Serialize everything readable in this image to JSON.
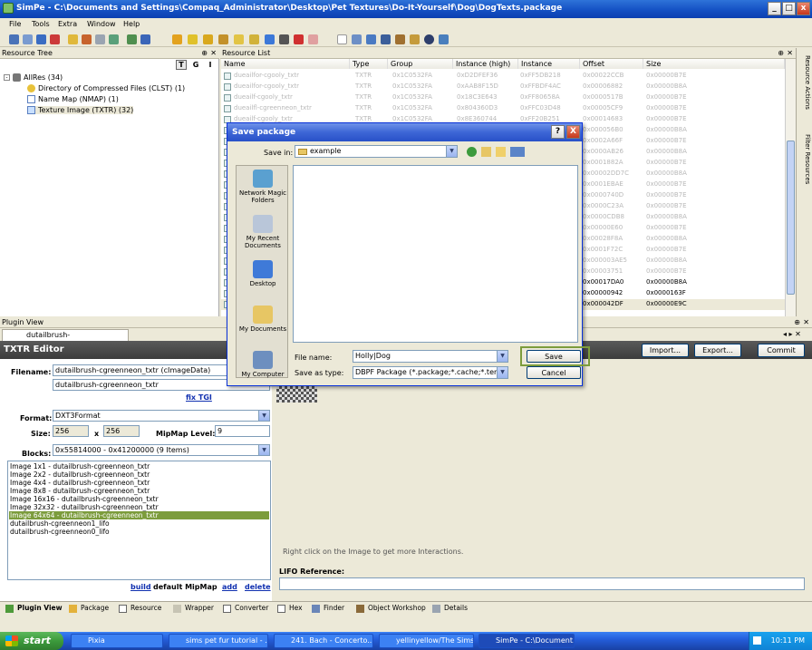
{
  "window": {
    "title": "SimPe - C:\\Documents and Settings\\Compaq_Administrator\\Desktop\\Pet Textures\\Do-It-Yourself\\Dog\\DogTexts.package"
  },
  "menu": [
    "File",
    "Tools",
    "Extra",
    "Window",
    "Help"
  ],
  "resource_tree": {
    "title": "Resource Tree",
    "view_buttons": [
      "T",
      "G",
      "I"
    ],
    "items": [
      {
        "label": "AllRes (34)"
      },
      {
        "label": "Directory of Compressed Files (CLST) (1)"
      },
      {
        "label": "Name Map (NMAP) (1)"
      },
      {
        "label": "Texture Image (TXTR) (32)"
      }
    ]
  },
  "resource_list": {
    "title": "Resource List",
    "columns": [
      "Name",
      "Type",
      "Group",
      "Instance (high)",
      "Instance",
      "Offset",
      "Size"
    ],
    "rows": [
      [
        "dueailfor-cgooly_txtr",
        "TXTR",
        "0x1C0532FA",
        "0xD2DFEF36",
        "0xFF5DB218",
        "0x00022CCB",
        "0x00000B7E"
      ],
      [
        "dueailfor-cgooly_txtr",
        "TXTR",
        "0x1C0532FA",
        "0xAAB8F15D",
        "0xFFBDF4AC",
        "0x00006882",
        "0x00000B8A"
      ],
      [
        "dueailf-cgooly_txtr",
        "TXTR",
        "0x1C0532FA",
        "0x18C3E643",
        "0xFF80658A",
        "0x0000517B",
        "0x00000B7E"
      ],
      [
        "dueailfl-cgreenneon_txtr",
        "TXTR",
        "0x1C0532FA",
        "0x804360D3",
        "0xFFC03D48",
        "0x00005CF9",
        "0x00000B7E"
      ],
      [
        "dueailf-cgooly_txtr",
        "TXTR",
        "0x1C0532FA",
        "0x8E360744",
        "0xFF20B251",
        "0x00014683",
        "0x00000B7E"
      ],
      [
        "",
        "",
        "",
        "",
        "",
        "0x000056B0",
        "0x00000B8A"
      ],
      [
        "",
        "",
        "",
        "",
        "",
        "0x0002A66F",
        "0x00000B7E"
      ],
      [
        "",
        "",
        "",
        "",
        "",
        "0x0000AB26",
        "0x00000B8A"
      ],
      [
        "",
        "",
        "",
        "",
        "",
        "0x0001882A",
        "0x00000B7E"
      ],
      [
        "",
        "",
        "",
        "",
        "",
        "0x00002DD7C",
        "0x00000B8A"
      ],
      [
        "",
        "",
        "",
        "",
        "",
        "0x0001EBAE",
        "0x00000B7E"
      ],
      [
        "",
        "",
        "",
        "",
        "",
        "0x0000740D",
        "0x00000B7E"
      ],
      [
        "",
        "",
        "",
        "",
        "",
        "0x0000C23A",
        "0x00000B7E"
      ],
      [
        "",
        "",
        "",
        "",
        "",
        "0x0000CDB8",
        "0x00000B8A"
      ],
      [
        "",
        "",
        "",
        "",
        "",
        "0x00000E60",
        "0x00000B7E"
      ],
      [
        "",
        "",
        "",
        "",
        "",
        "0x00028F8A",
        "0x00000B8A"
      ],
      [
        "",
        "",
        "",
        "",
        "",
        "0x0001F72C",
        "0x00000B7E"
      ],
      [
        "",
        "",
        "",
        "",
        "",
        "0x000003AE5",
        "0x00000B8A"
      ],
      [
        "",
        "",
        "",
        "",
        "",
        "0x00003751",
        "0x00000B7E"
      ],
      [
        "",
        "",
        "",
        "",
        "",
        "0x00017DA0",
        "0x00000B8A"
      ],
      [
        "",
        "",
        "",
        "",
        "",
        "0x00000942",
        "0x0000163F"
      ],
      [
        "",
        "",
        "",
        "",
        "",
        "0x000042DF",
        "0x00000E9C"
      ]
    ]
  },
  "side_tabs": [
    "Resource Actions",
    "Filter Resources"
  ],
  "plugin_view": {
    "title": "Plugin View",
    "doc_tab": "dutailbrush-cgreenneon_txtr",
    "editor_title": "TXTR Editor",
    "buttons": {
      "import": "Import...",
      "export": "Export...",
      "commit": "Commit"
    },
    "filename_label": "Filename:",
    "filename_value": "dutailbrush-cgreenneon_txtr (cImageData)",
    "filename_value2": "dutailbrush-cgreenneon_txtr",
    "fix_tgi": "fix TGI",
    "format_label": "Format:",
    "format_value": "DXT3Format",
    "size_label": "Size:",
    "size_w": "256",
    "size_x": "x",
    "size_h": "256",
    "mipmap_label": "MipMap Level:",
    "mipmap_value": "9",
    "blocks_label": "Blocks:",
    "blocks_value": "0x55814000 - 0x41200000 (9 Items)",
    "images": [
      "Image 1x1 - dutailbrush-cgreenneon_txtr",
      "Image 2x2 - dutailbrush-cgreenneon_txtr",
      "Image 4x4 - dutailbrush-cgreenneon_txtr",
      "Image 8x8 - dutailbrush-cgreenneon_txtr",
      "Image 16x16 - dutailbrush-cgreenneon_txtr",
      "Image 32x32 - dutailbrush-cgreenneon_txtr",
      "Image 64x64 - dutailbrush-cgreenneon_txtr",
      "dutailbrush-cgreenneon1_lifo",
      "dutailbrush-cgreenneon0_lifo"
    ],
    "selected_image_index": 6,
    "build": "build",
    "default_mipmap": "default MipMap",
    "add": "add",
    "delete": "delete",
    "hint": "Right click on the Image to get more Interactions.",
    "lifo_label": "LIFO Reference:"
  },
  "bottom_tabs": [
    "Plugin View",
    "Package",
    "Resource",
    "Wrapper",
    "Converter",
    "Hex",
    "Finder",
    "Object Workshop",
    "Details"
  ],
  "dialog": {
    "title": "Save package",
    "help": "?",
    "close": "X",
    "save_in_label": "Save in:",
    "save_in_value": "example",
    "places": [
      "Network Magic Folders",
      "My Recent Documents",
      "Desktop",
      "My Documents",
      "My Computer"
    ],
    "file_name_label": "File name:",
    "file_name_value": "Holly|Dog",
    "save_as_label": "Save as type:",
    "save_as_value": "DBPF Package (*.package;*.cache;*.template;",
    "save_button": "Save",
    "cancel_button": "Cancel"
  },
  "taskbar": {
    "start": "start",
    "tasks": [
      "Pixia",
      "sims pet fur tutorial - ...",
      "241. Bach - Concerto...",
      "yellinyellow/The Sims...",
      "SimPe - C:\\Document..."
    ],
    "clock": "10:11 PM"
  },
  "colors": {
    "xp_blue": "#245edb",
    "title_blue": "#1551c4",
    "highlight_green": "#7c9c3c"
  }
}
